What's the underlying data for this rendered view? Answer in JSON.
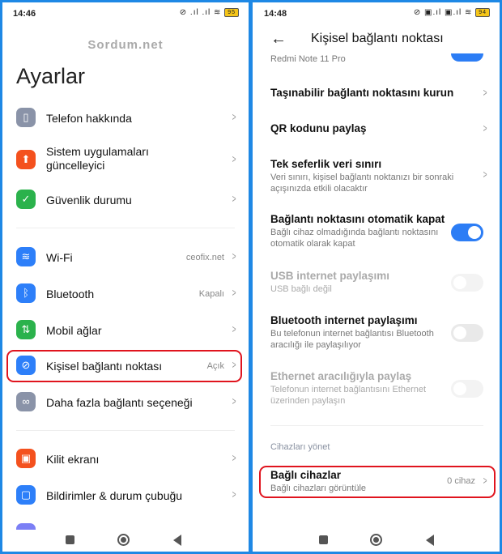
{
  "left": {
    "status": {
      "time": "14:46",
      "battery": "95"
    },
    "watermark": "Sordum.net",
    "title": "Ayarlar",
    "items": [
      {
        "label": "Telefon hakkında",
        "icon": "phone-icon",
        "color": "#8a93a8"
      },
      {
        "label": "Sistem uygulamaları güncelleyici",
        "line1": "Sistem uygulamaları",
        "line2": "güncelleyici",
        "icon": "upload-arrow-icon",
        "color": "#f4511e"
      },
      {
        "label": "Güvenlik durumu",
        "icon": "shield-check-icon",
        "color": "#2bb24c"
      },
      {
        "label": "Wi-Fi",
        "value": "ceofix.net",
        "icon": "wifi-icon",
        "color": "#2d7ff9"
      },
      {
        "label": "Bluetooth",
        "value": "Kapalı",
        "icon": "bluetooth-icon",
        "color": "#2d7ff9"
      },
      {
        "label": "Mobil ağlar",
        "icon": "mobile-data-icon",
        "color": "#2bb24c"
      },
      {
        "label": "Kişisel bağlantı noktası",
        "value": "Açık",
        "icon": "hotspot-icon",
        "color": "#2d7ff9"
      },
      {
        "label": "Daha fazla bağlantı seçeneği",
        "icon": "link-icon",
        "color": "#8a93a8"
      },
      {
        "label": "Kilit ekranı",
        "icon": "lock-icon",
        "color": "#f4511e"
      },
      {
        "label": "Bildirimler & durum çubuğu",
        "icon": "notification-icon",
        "color": "#2d7ff9"
      }
    ]
  },
  "right": {
    "status": {
      "time": "14:48",
      "battery": "94"
    },
    "header": {
      "title": "Kişisel bağlantı noktası"
    },
    "cut_text": "Redmi Note 11 Pro",
    "rows": [
      {
        "title": "Taşınabilir bağlantı noktasını kurun"
      },
      {
        "title": "QR kodunu paylaş"
      },
      {
        "title": "Tek seferlik veri sınırı",
        "sub": "Veri sınırı, kişisel bağlantı noktanızı bir sonraki açışınızda etkili olacaktır"
      },
      {
        "title": "Bağlantı noktasını otomatik kapat",
        "sub": "Bağlı cihaz olmadığında bağlantı noktasını otomatik olarak kapat",
        "toggle": true
      },
      {
        "title": "USB internet paylaşımı",
        "sub": "USB bağlı değil",
        "toggle": false,
        "disabled": true
      },
      {
        "title": "Bluetooth internet paylaşımı",
        "sub": "Bu telefonun internet bağlantısı Bluetooth aracılığı ile paylaşılıyor",
        "toggle": false
      },
      {
        "title": "Ethernet aracılığıyla paylaş",
        "sub": "Telefonun internet bağlantısını Ethernet üzerinden paylaşın",
        "toggle": false,
        "disabled": true
      }
    ],
    "section": "Cihazları yönet",
    "devices": {
      "title": "Bağlı cihazlar",
      "sub": "Bağlı cihazları görüntüle",
      "value": "0 cihaz"
    }
  },
  "colors": {
    "accent": "#2c7df5",
    "highlight": "#e0141e",
    "frame": "#1e88e5"
  }
}
